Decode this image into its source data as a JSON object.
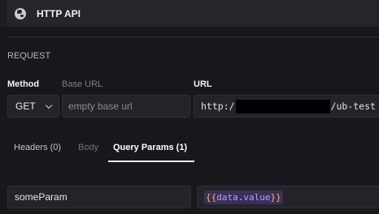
{
  "header": {
    "title": "HTTP API",
    "icon": "globe-icon"
  },
  "request": {
    "section_label": "REQUEST",
    "method_label": "Method",
    "base_url_label": "Base URL",
    "url_label": "URL",
    "method_value": "GET",
    "base_url_placeholder": "empty base url",
    "url_prefix": "http:/",
    "url_suffix": "/ub-test"
  },
  "tabs": [
    {
      "label": "Headers (0)",
      "active": false
    },
    {
      "label": "Body",
      "active": false
    },
    {
      "label": "Query Params (1)",
      "active": true
    }
  ],
  "query_params": [
    {
      "name": "someParam",
      "value_open": "{{",
      "value_obj": "data",
      "value_dot": ".",
      "value_key": "value",
      "value_close": "}}"
    }
  ],
  "colors": {
    "background": "#17181c",
    "template_chip": "#3a2f57",
    "brace": "#e7c34b",
    "variable": "#b9a0ff"
  }
}
